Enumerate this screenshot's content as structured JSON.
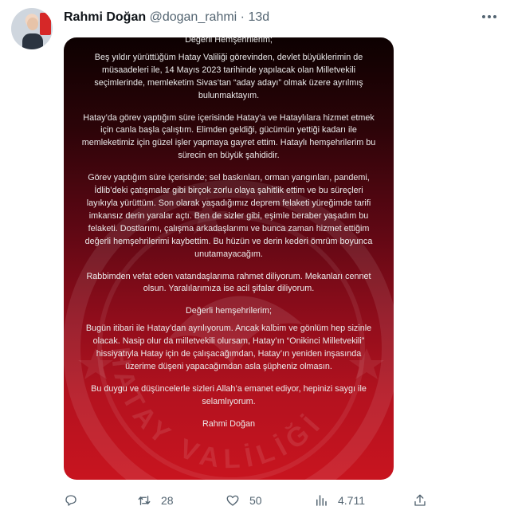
{
  "author": {
    "name": "Rahmi Doğan",
    "handle": "@dogan_rahmi",
    "separator": "·",
    "time": "13d"
  },
  "letter": {
    "greeting": "Değerli Hemşehrilerim;",
    "paragraphs": [
      "Beş yıldır yürüttüğüm Hatay Valiliği görevinden, devlet büyüklerimin de müsaadeleri ile, 14 Mayıs 2023 tarihinde yapılacak olan Milletvekili seçimlerinde, memleketim Sivas’tan “aday adayı” olmak üzere ayrılmış bulunmaktayım.",
      "Hatay’da görev yaptığım süre içerisinde Hatay’a ve Hataylılara hizmet etmek için canla başla çalıştım. Elimden geldiği, gücümün yettiği kadarı ile memleketimiz için güzel işler yapmaya gayret ettim. Hataylı hemşehrilerim bu sürecin en büyük şahididir.",
      "Görev yaptığım süre içerisinde; sel baskınları, orman yangınları, pandemi, İdlib’deki çatışmalar gibi birçok zorlu olaya şahitlik ettim ve bu süreçleri layıkıyla yürüttüm. Son olarak yaşadığımız deprem felaketi yüreğimde tarifi imkansız derin yaralar açtı. Ben de sizler gibi, eşimle beraber yaşadım bu felaketi. Dostlarımı, çalışma arkadaşlarımı ve bunca zaman hizmet ettiğim değerli hemşehrilerimi kaybettim. Bu hüzün ve derin kederi ömrüm boyunca unutamayacağım.",
      "Rabbimden vefat eden vatandaşlarıma rahmet diliyorum. Mekanları cennet olsun. Yaralılarımıza ise acil şifalar diliyorum."
    ],
    "greeting2": "Değerli hemşehrilerim;",
    "paragraph5": "Bugün itibari ile Hatay’dan ayrılıyorum. Ancak kalbim ve gönlüm hep sizinle olacak. Nasip olur da milletvekili olursam, Hatay’ın “Onikinci Milletvekili” hissiyatıyla Hatay için de çalışacağımdan, Hatay’ın yeniden inşasında üzerime düşeni yapacağımdan asla şüpheniz olmasın.",
    "paragraph6": "Bu duygu ve düşüncelerle sizleri Allah’a emanet ediyor, hepinizi saygı ile selamlıyorum.",
    "signature": "Rahmi Doğan"
  },
  "emblem_text": "HATAY VALİLİĞİ",
  "actions": {
    "reply_count": "",
    "retweet_count": "28",
    "like_count": "50",
    "views_count": "4.711"
  },
  "icons": {
    "more": "more-icon",
    "reply": "reply-icon",
    "retweet": "retweet-icon",
    "like": "heart-icon",
    "views": "views-icon",
    "share": "share-icon"
  },
  "colors": {
    "card_top": "#0d0101",
    "card_bottom": "#c8141f",
    "text_primary": "#0f1419",
    "text_secondary": "#536471"
  }
}
